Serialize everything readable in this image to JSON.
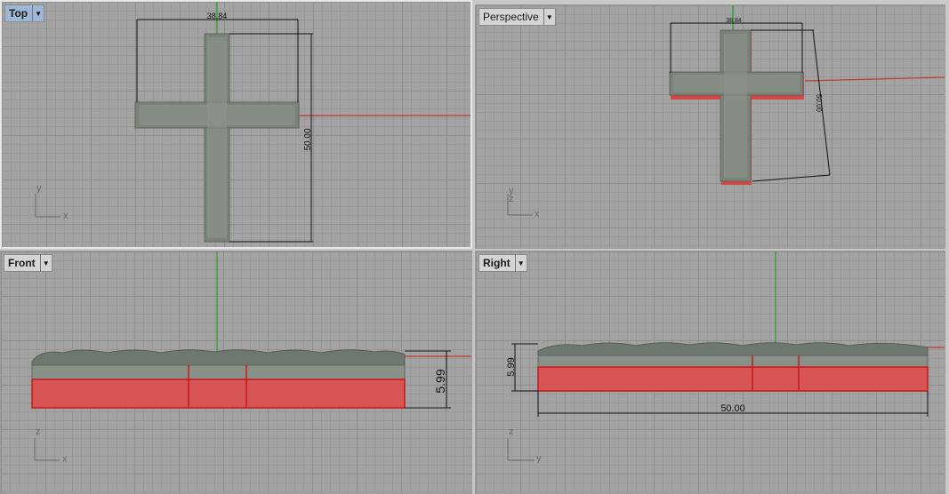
{
  "viewports": {
    "top": {
      "title": "Top",
      "active": true,
      "dims": {
        "width": "38.84",
        "height": "50.00"
      },
      "axes": {
        "a": "y",
        "b": "x"
      }
    },
    "perspective": {
      "title": "Perspective",
      "dims": {
        "width": "38.84",
        "height": "50.00"
      },
      "axes": {
        "a": "y",
        "b": "x",
        "c": "z"
      }
    },
    "front": {
      "title": "Front",
      "dims": {
        "thickness": "5.99"
      },
      "axes": {
        "a": "z",
        "b": "x"
      }
    },
    "right": {
      "title": "Right",
      "dims": {
        "thickness": "5.99",
        "length": "50.00"
      },
      "axes": {
        "a": "z",
        "b": "y"
      }
    }
  },
  "icons": {
    "dropdown": "chevron-down-icon"
  },
  "colors": {
    "model": "#7f877f",
    "selected_base": "#d64545",
    "x_axis": "#c0392b",
    "y_axis": "#3aa33a"
  }
}
